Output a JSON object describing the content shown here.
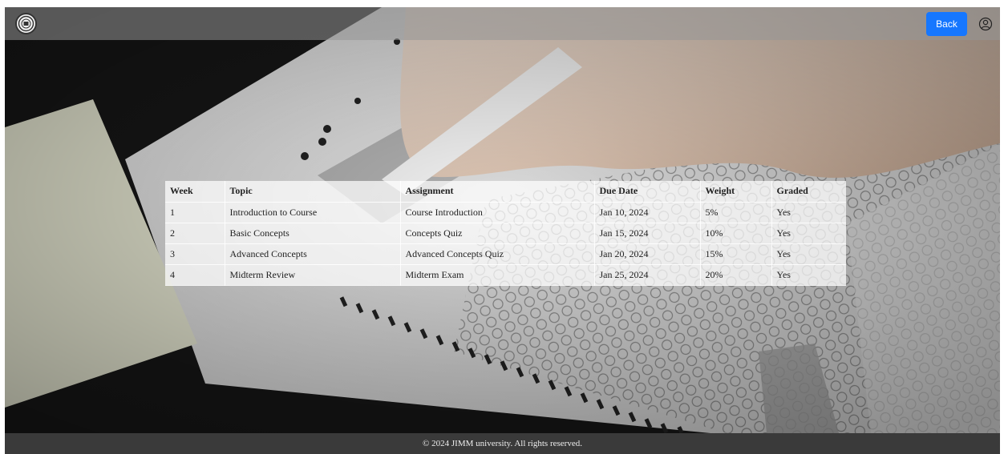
{
  "header": {
    "logo_icon": "university-seal-icon",
    "back_label": "Back",
    "user_icon": "user-circle-icon"
  },
  "schedule": {
    "columns": [
      "Week",
      "Topic",
      "Assignment",
      "Due Date",
      "Weight",
      "Graded"
    ],
    "rows": [
      [
        "1",
        "Introduction to Course",
        "Course Introduction",
        "Jan 10, 2024",
        "5%",
        "Yes"
      ],
      [
        "2",
        "Basic Concepts",
        "Concepts Quiz",
        "Jan 15, 2024",
        "10%",
        "Yes"
      ],
      [
        "3",
        "Advanced Concepts",
        "Advanced Concepts Quiz",
        "Jan 20, 2024",
        "15%",
        "Yes"
      ],
      [
        "4",
        "Midterm Review",
        "Midterm Exam",
        "Jan 25, 2024",
        "20%",
        "Yes"
      ]
    ]
  },
  "footer": {
    "text": "© 2024 JIMM university. All rights reserved."
  },
  "colors": {
    "accent": "#1677ff",
    "footer_bg": "#3a3a3a"
  }
}
